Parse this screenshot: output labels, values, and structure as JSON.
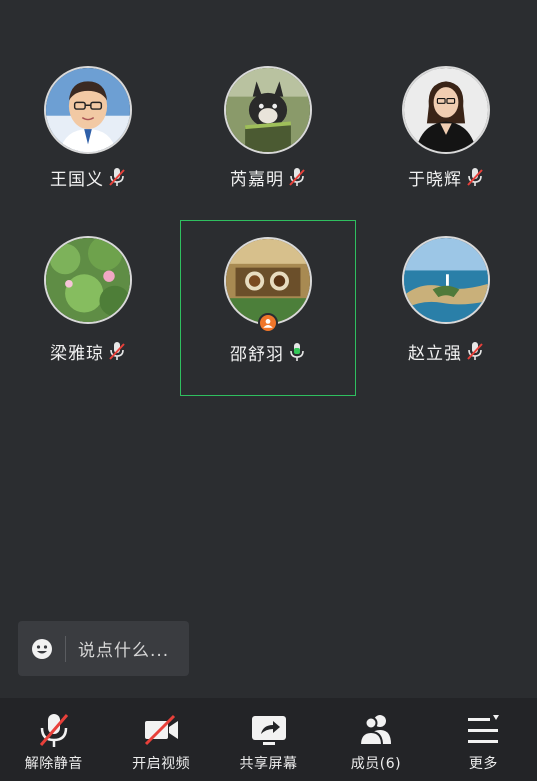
{
  "participants": [
    {
      "name": "王国义",
      "mic": "muted",
      "avatar": "cartoon-man-glasses-avatar"
    },
    {
      "name": "芮嘉明",
      "mic": "muted",
      "avatar": "dog-photo-avatar"
    },
    {
      "name": "于晓辉",
      "mic": "muted",
      "avatar": "woman-portrait-avatar"
    },
    {
      "name": "梁雅琼",
      "mic": "muted",
      "avatar": "lotus-pond-avatar"
    },
    {
      "name": "邵舒羽",
      "mic": "active",
      "avatar": "food-collage-avatar",
      "host": true,
      "speaking": true
    },
    {
      "name": "赵立强",
      "mic": "muted",
      "avatar": "coastline-avatar"
    }
  ],
  "chat": {
    "placeholder": "说点什么..."
  },
  "toolbar": {
    "unmute": "解除静音",
    "video": "开启视频",
    "share": "共享屏幕",
    "members": "成员(6)",
    "more": "更多"
  },
  "colors": {
    "background": "#2b2d30",
    "active_border": "#2fbf5f",
    "muted_red": "#e8403a",
    "mic_green": "#35c759",
    "host_badge": "#f0762a"
  }
}
